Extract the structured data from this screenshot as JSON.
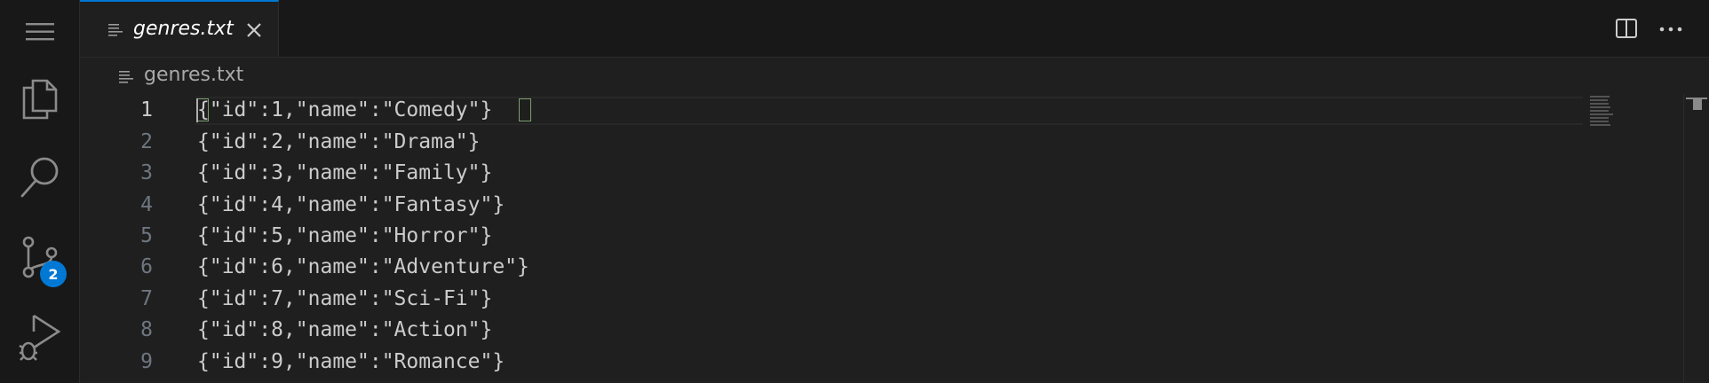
{
  "tab": {
    "label": "genres.txt",
    "icon": "file-lines-icon",
    "close_icon": "close-icon"
  },
  "breadcrumb": {
    "label": "genres.txt",
    "icon": "file-lines-icon"
  },
  "activity_bar": {
    "items": [
      {
        "name": "menu",
        "icon": "hamburger-menu-icon"
      },
      {
        "name": "explorer",
        "icon": "files-icon"
      },
      {
        "name": "search",
        "icon": "search-icon"
      },
      {
        "name": "source-control",
        "icon": "source-control-icon",
        "badge": "2"
      },
      {
        "name": "run-debug",
        "icon": "run-debug-icon"
      }
    ]
  },
  "editor_actions": {
    "split": "split-editor-icon",
    "more": "more-actions-icon"
  },
  "colors": {
    "accent": "#0078d4",
    "bracket_highlight": "#7e9e6e"
  },
  "lines": [
    {
      "num": "1",
      "text": "{\"id\":1,\"name\":\"Comedy\"}"
    },
    {
      "num": "2",
      "text": "{\"id\":2,\"name\":\"Drama\"}"
    },
    {
      "num": "3",
      "text": "{\"id\":3,\"name\":\"Family\"}"
    },
    {
      "num": "4",
      "text": "{\"id\":4,\"name\":\"Fantasy\"}"
    },
    {
      "num": "5",
      "text": "{\"id\":5,\"name\":\"Horror\"}"
    },
    {
      "num": "6",
      "text": "{\"id\":6,\"name\":\"Adventure\"}"
    },
    {
      "num": "7",
      "text": "{\"id\":7,\"name\":\"Sci-Fi\"}"
    },
    {
      "num": "8",
      "text": "{\"id\":8,\"name\":\"Action\"}"
    },
    {
      "num": "9",
      "text": "{\"id\":9,\"name\":\"Romance\"}"
    }
  ]
}
